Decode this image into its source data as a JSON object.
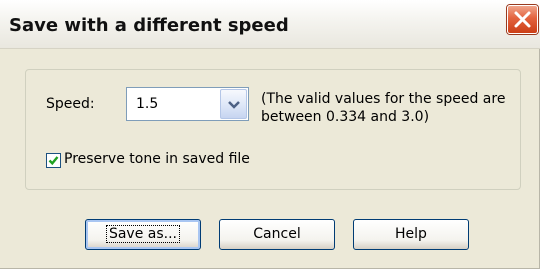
{
  "window": {
    "title": "Save with a different speed",
    "close_icon": "close-x-icon"
  },
  "speed": {
    "label": "Speed:",
    "value": "1.5",
    "hint": "(The valid values for the speed are between 0.334 and 3.0)"
  },
  "preserve_tone": {
    "label": "Preserve tone in saved file",
    "checked": true
  },
  "buttons": {
    "save_as": "Save as...",
    "cancel": "Cancel",
    "help": "Help"
  },
  "colors": {
    "dialog_bg": "#ece9d8",
    "close_button": "#e3633e",
    "check_mark": "#21a121",
    "button_border": "#003c74"
  }
}
